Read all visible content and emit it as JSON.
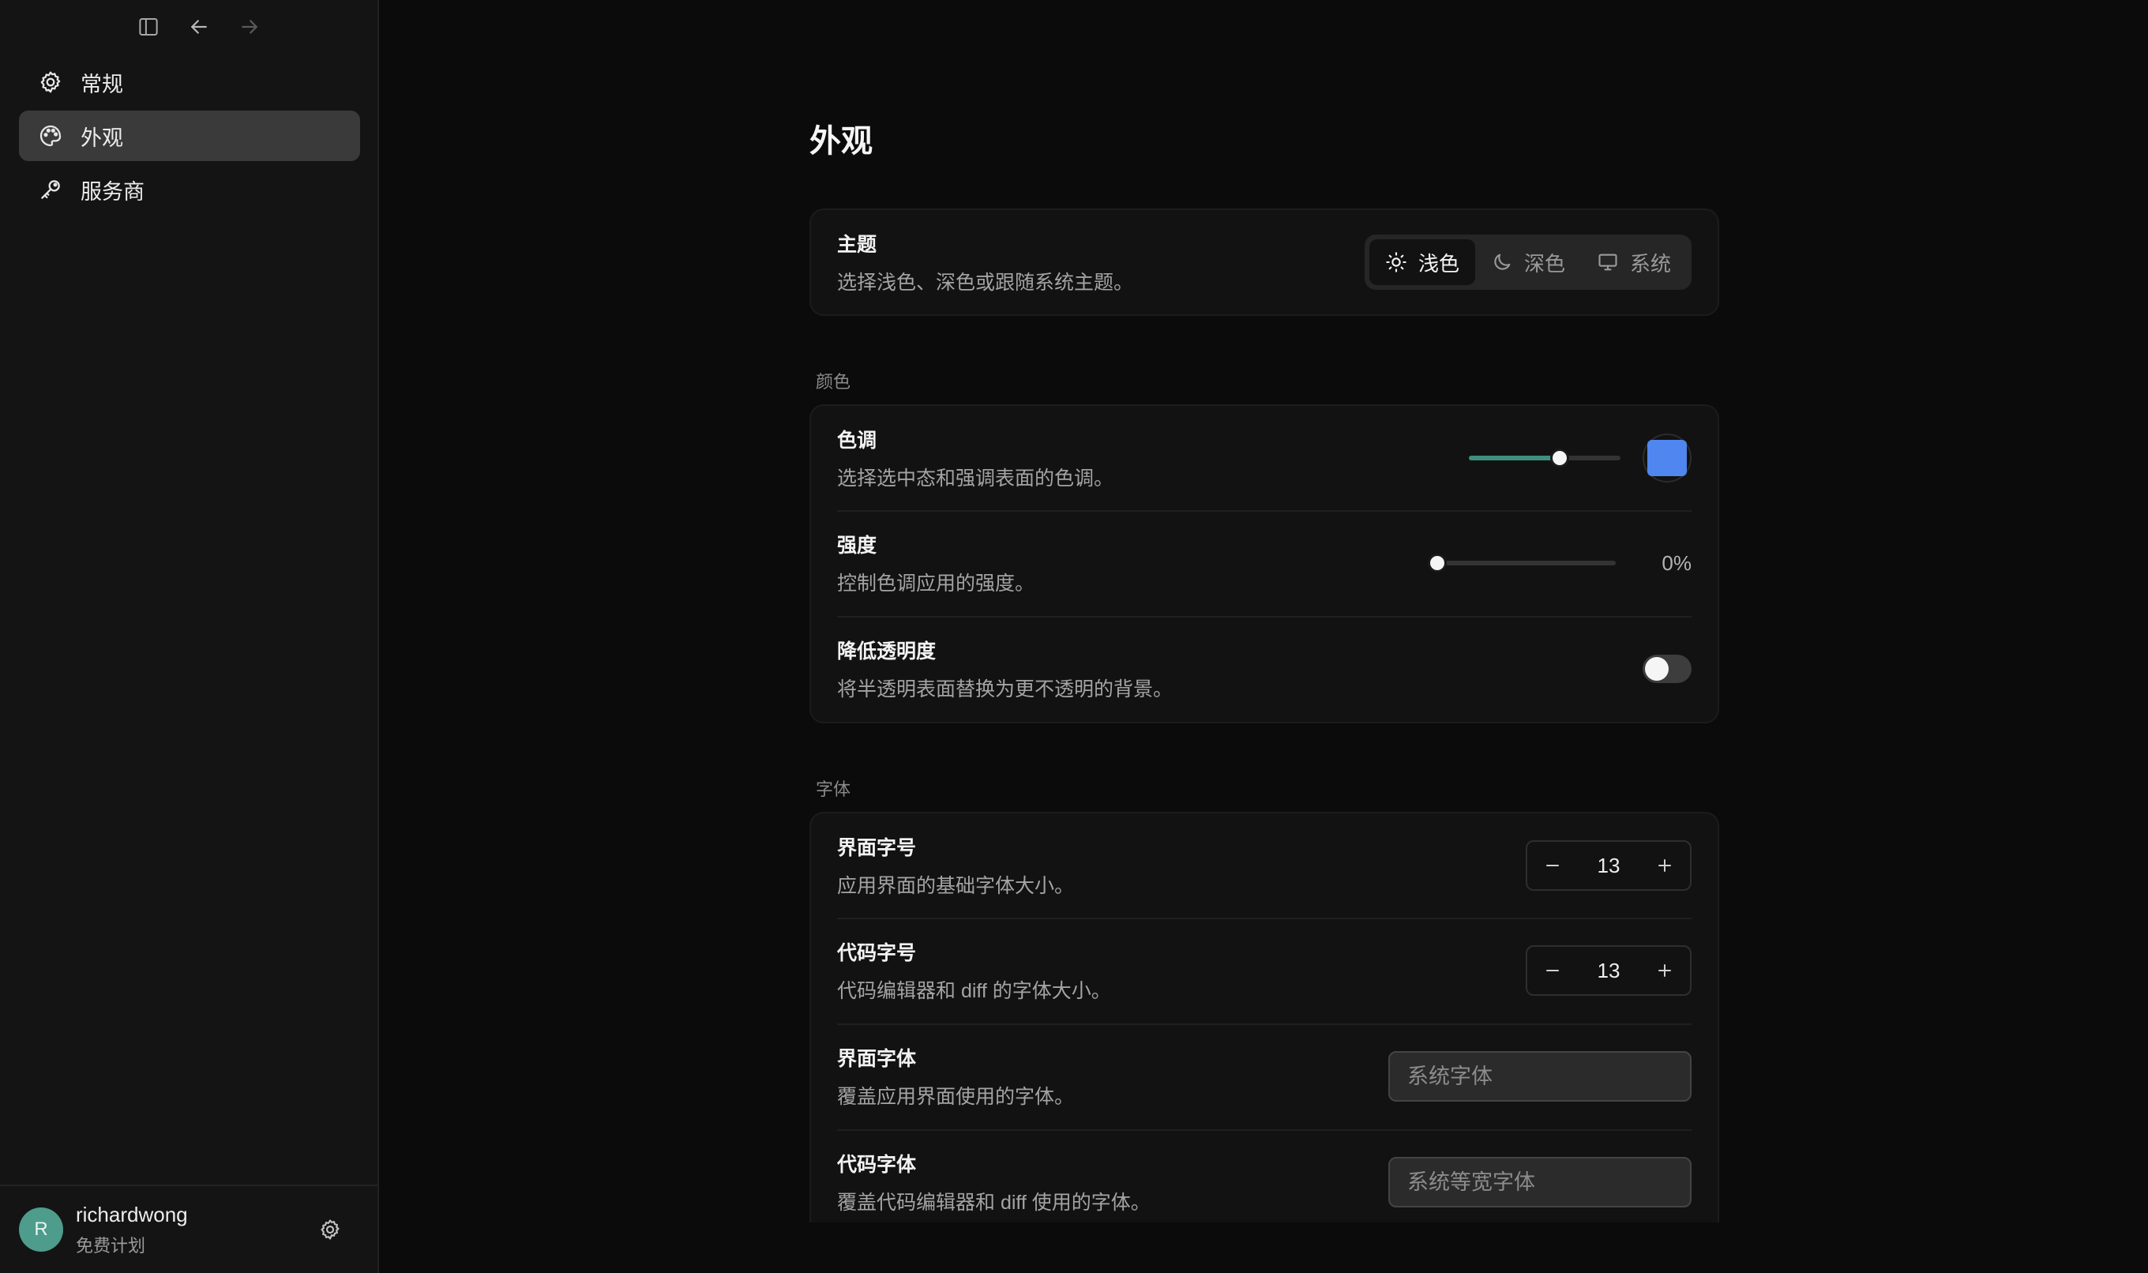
{
  "sidebar": {
    "nav": [
      {
        "label": "常规",
        "icon": "gear-icon",
        "active": false
      },
      {
        "label": "外观",
        "icon": "palette-icon",
        "active": true
      },
      {
        "label": "服务商",
        "icon": "key-icon",
        "active": false
      }
    ],
    "user": {
      "initial": "R",
      "name": "richardwong",
      "plan": "免费计划"
    }
  },
  "page": {
    "title": "外观"
  },
  "theme": {
    "title": "主题",
    "desc": "选择浅色、深色或跟随系统主题。",
    "options": [
      {
        "label": "浅色",
        "icon": "sun-icon",
        "selected": true
      },
      {
        "label": "深色",
        "icon": "moon-icon",
        "selected": false
      },
      {
        "label": "系统",
        "icon": "monitor-icon",
        "selected": false
      }
    ]
  },
  "color": {
    "section_label": "颜色",
    "hue": {
      "title": "色调",
      "desc": "选择选中态和强调表面的色调。",
      "slider_fraction": 0.6,
      "track_color": "#3e8f7d",
      "swatch_color": "#4f86f0"
    },
    "intensity": {
      "title": "强度",
      "desc": "控制色调应用的强度。",
      "value": "0%",
      "slider_fraction": 0.0
    },
    "reduce_transparency": {
      "title": "降低透明度",
      "desc": "将半透明表面替换为更不透明的背景。",
      "enabled": false
    }
  },
  "fonts": {
    "section_label": "字体",
    "ui_size": {
      "title": "界面字号",
      "desc": "应用界面的基础字体大小。",
      "value": "13"
    },
    "code_size": {
      "title": "代码字号",
      "desc": "代码编辑器和 diff 的字体大小。",
      "value": "13"
    },
    "ui_font": {
      "title": "界面字体",
      "desc": "覆盖应用界面使用的字体。",
      "placeholder": "系统字体"
    },
    "code_font": {
      "title": "代码字体",
      "desc": "覆盖代码编辑器和 diff 使用的字体。",
      "placeholder": "系统等宽字体"
    }
  }
}
